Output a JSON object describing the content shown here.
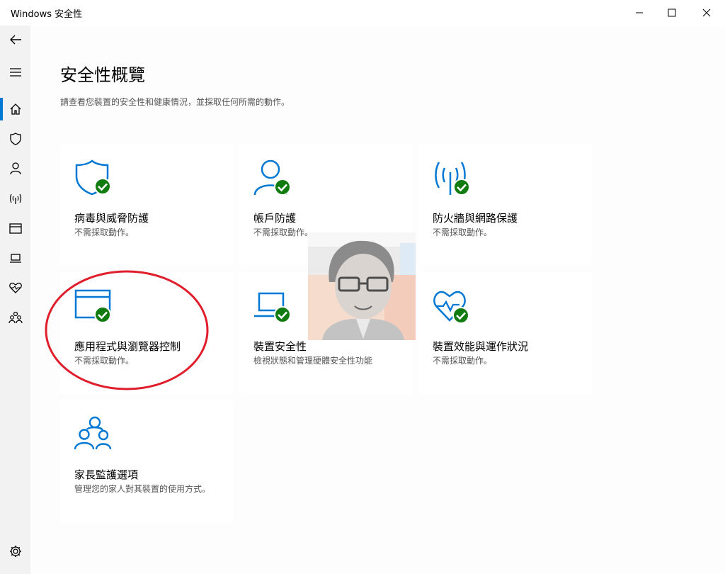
{
  "window": {
    "title": "Windows 安全性"
  },
  "page": {
    "title": "安全性概覽",
    "description": "請查看您裝置的安全性和健康情況，並採取任何所需的動作。"
  },
  "tiles": [
    {
      "name": "病毒與威脅防護",
      "status": "不需採取動作。",
      "icon": "shield-icon"
    },
    {
      "name": "帳戶防護",
      "status": "不需採取動作。",
      "icon": "person-icon"
    },
    {
      "name": "防火牆與網路保護",
      "status": "不需採取動作。",
      "icon": "wireless-icon"
    },
    {
      "name": "應用程式與瀏覽器控制",
      "status": "不需採取動作。",
      "icon": "app-window-icon"
    },
    {
      "name": "裝置安全性",
      "status": "檢視狀態和管理硬體安全性功能",
      "icon": "laptop-icon"
    },
    {
      "name": "裝置效能與運作狀況",
      "status": "不需採取動作。",
      "icon": "heart-pulse-icon"
    },
    {
      "name": "家長監護選項",
      "status": "管理您的家人對其裝置的使用方式。",
      "icon": "family-icon"
    }
  ],
  "colors": {
    "accent": "#0078d4",
    "ok_green": "#107c10",
    "annotation_red": "#e01e2b"
  }
}
